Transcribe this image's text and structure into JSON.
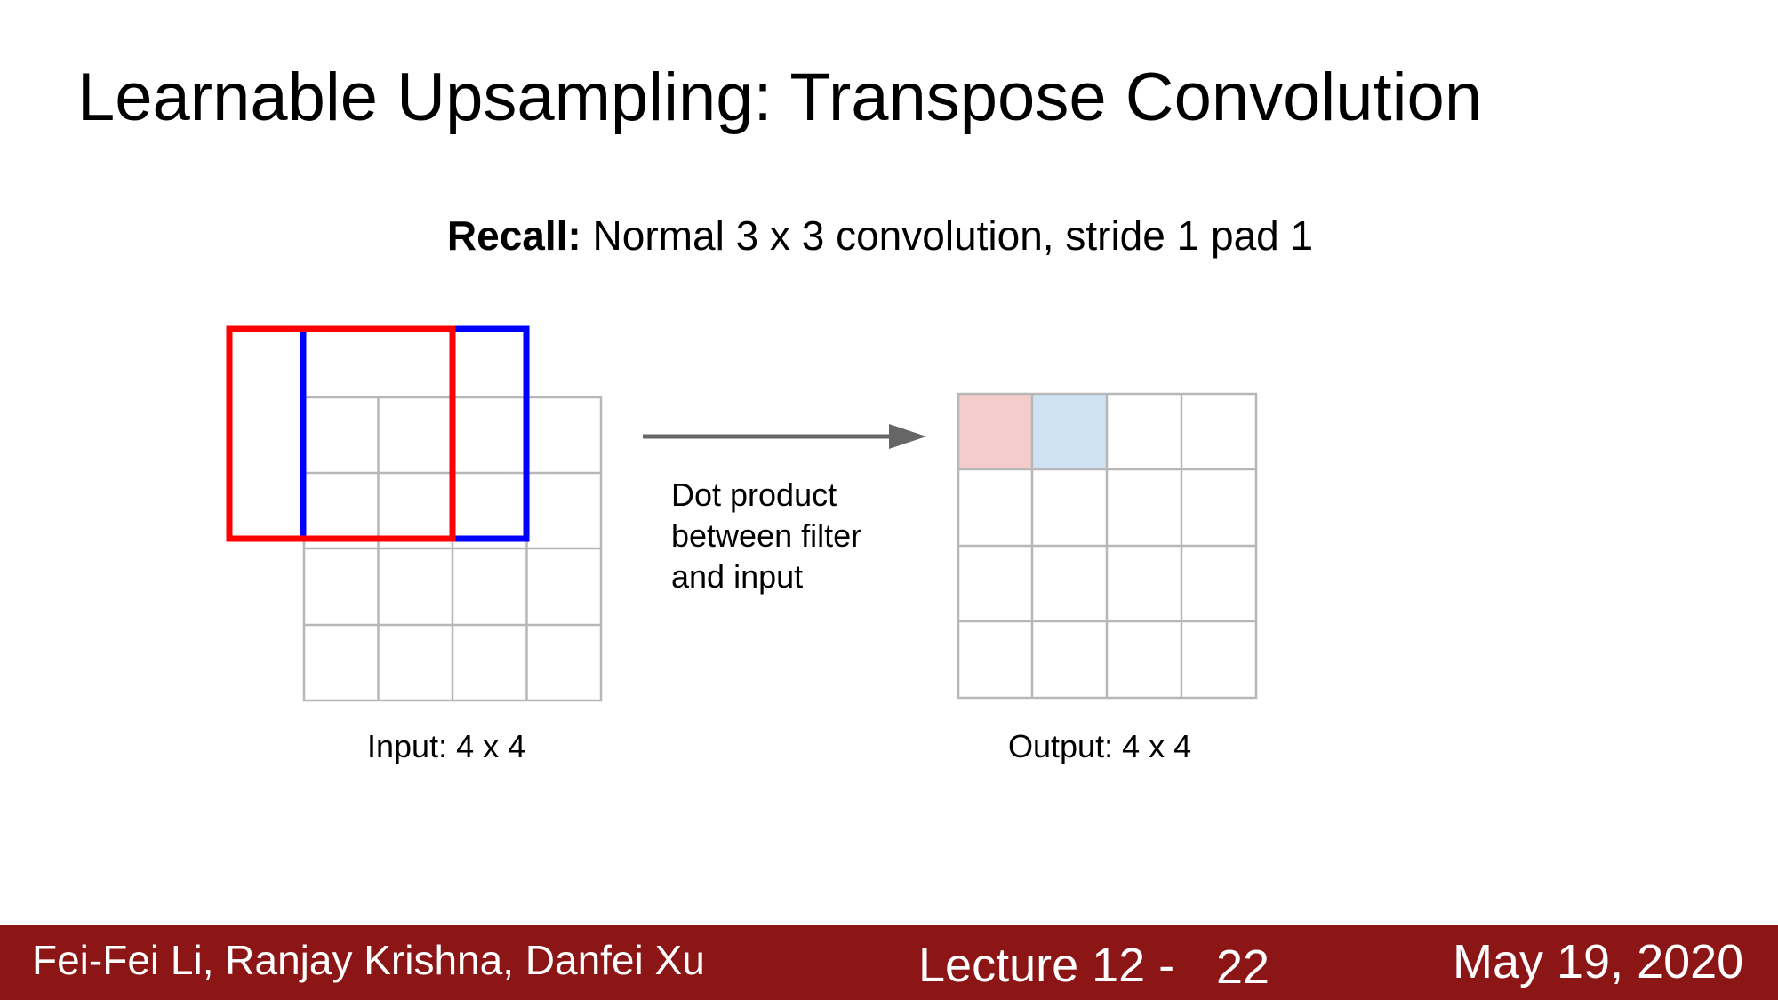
{
  "slide": {
    "title": "Learnable Upsampling: Transpose Convolution",
    "subtitle_bold": "Recall:",
    "subtitle_rest": " Normal 3 x 3 convolution, stride 1 pad 1"
  },
  "diagram": {
    "input_caption": "Input: 4 x 4",
    "output_caption": "Output: 4 x 4",
    "arrow_note_lines": [
      "Dot product",
      "between filter",
      "and input"
    ],
    "input_grid": {
      "rows": 4,
      "cols": 4
    },
    "output_grid": {
      "rows": 4,
      "cols": 4
    },
    "filter_colors": {
      "first": "#ff0000",
      "second": "#0000ff"
    },
    "output_cell_colors": {
      "first": "#f4cccc",
      "second": "#cfe2f3"
    }
  },
  "footer": {
    "authors": "Fei-Fei Li, Ranjay Krishna, Danfei Xu",
    "lecture": "Lecture 12 -",
    "page": "22",
    "date": "May 19, 2020",
    "background": "#8c1515"
  }
}
